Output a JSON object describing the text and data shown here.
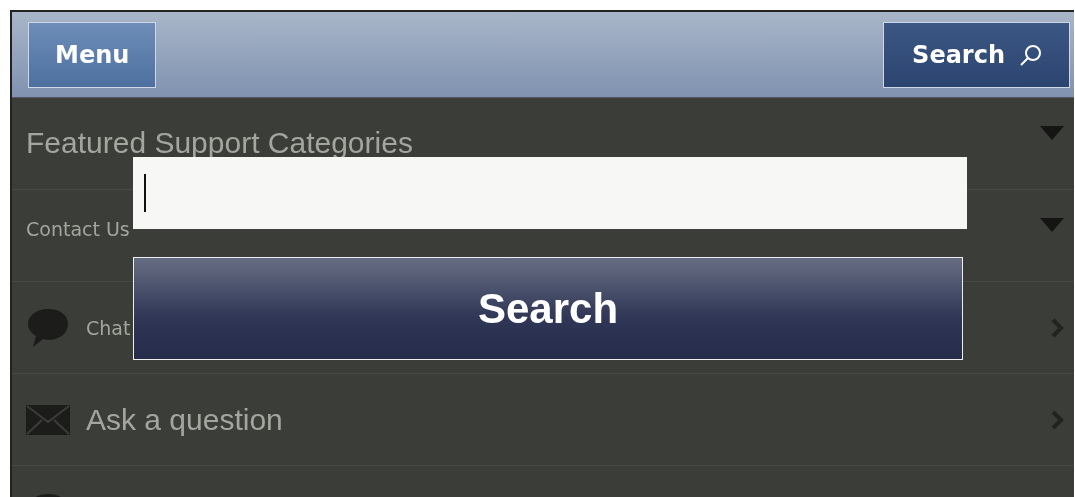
{
  "header": {
    "menu_button": "Menu",
    "search_button": "Search"
  },
  "sections": [
    {
      "kind": "accordion",
      "label": "Featured Support Categories"
    },
    {
      "kind": "accordion",
      "label": "Contact Us"
    },
    {
      "kind": "chat",
      "label": "Chat"
    },
    {
      "kind": "mail",
      "label": "Ask a question"
    },
    {
      "kind": "chat-partial"
    }
  ],
  "search_popup": {
    "focused": true,
    "button": "Search"
  }
}
